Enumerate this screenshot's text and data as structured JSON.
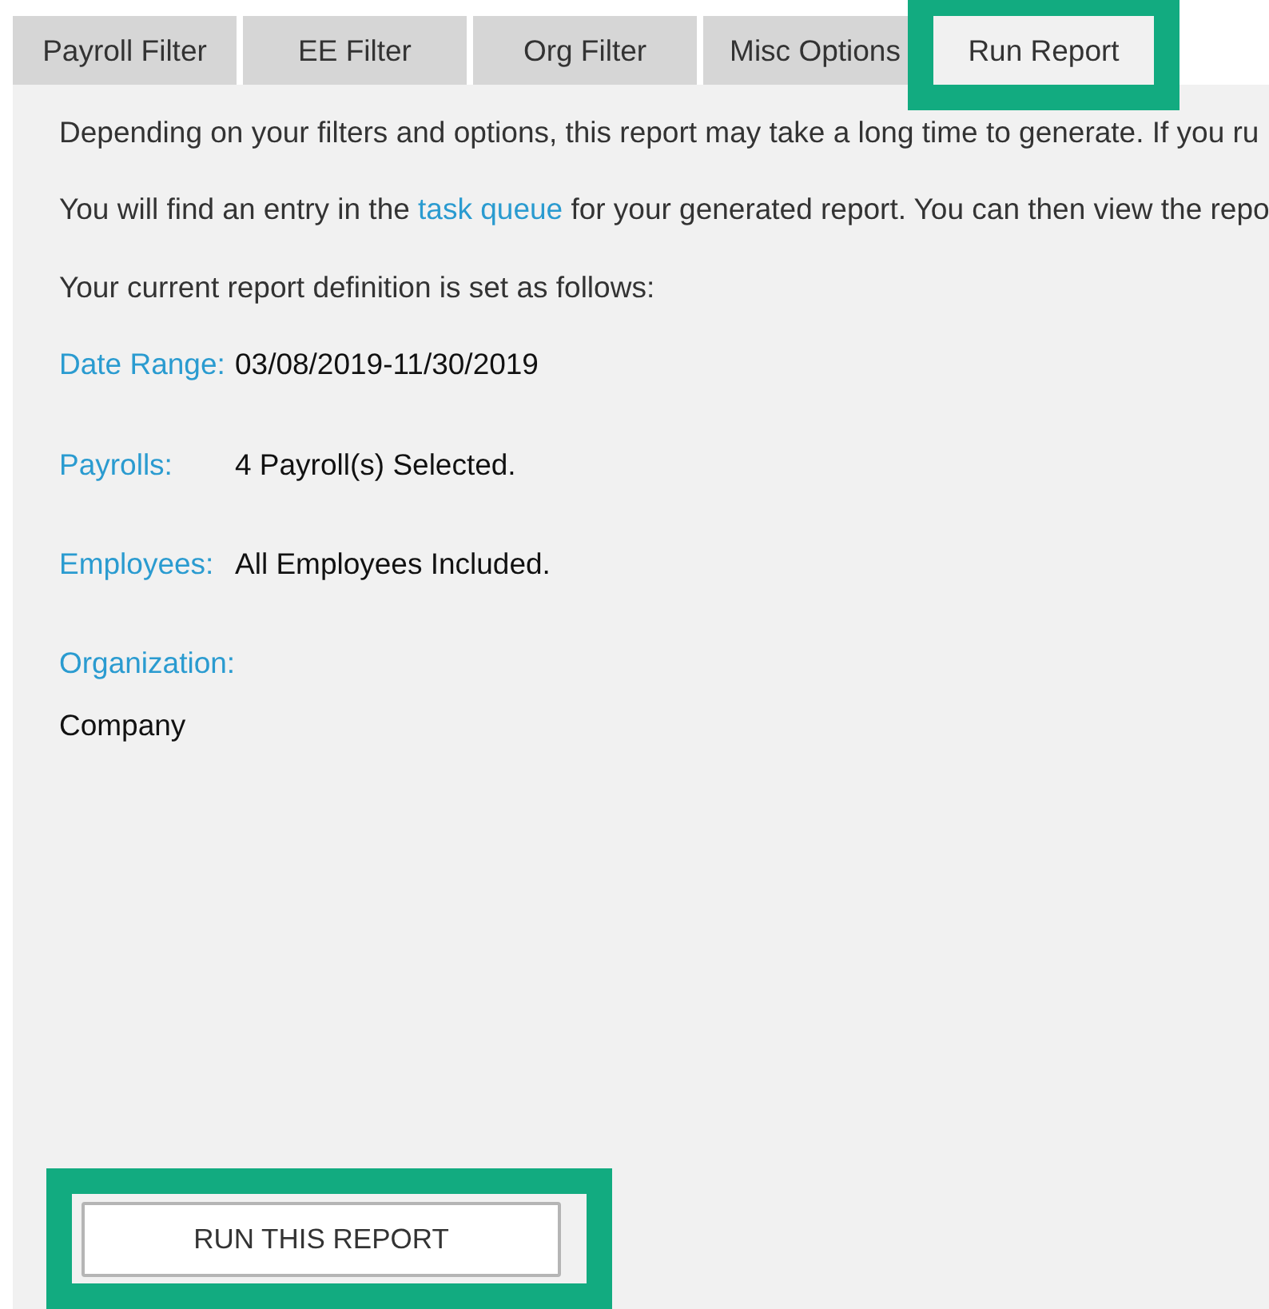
{
  "tabs": [
    {
      "label": "Payroll Filter",
      "selected": false,
      "highlighted": false
    },
    {
      "label": "EE Filter",
      "selected": false,
      "highlighted": false
    },
    {
      "label": "Org Filter",
      "selected": false,
      "highlighted": false
    },
    {
      "label": "Misc Options",
      "selected": false,
      "highlighted": false
    },
    {
      "label": "Run Report",
      "selected": true,
      "highlighted": true
    }
  ],
  "intro": [
    {
      "kind": "text",
      "parts": [
        {
          "text": "Depending on your filters and options, this report may take a long time to generate. If you ru"
        }
      ]
    },
    {
      "kind": "text",
      "parts": [
        {
          "text": "You will find an entry in the "
        },
        {
          "text": "task queue",
          "link": true
        },
        {
          "text": " for your generated report. You can then view the repo"
        }
      ]
    },
    {
      "kind": "text",
      "parts": [
        {
          "text": "Your current report definition is set as follows:"
        }
      ]
    }
  ],
  "definition": [
    {
      "label": "Date Range:",
      "value": "03/08/2019-11/30/2019",
      "kind": "inline"
    },
    {
      "label": "Payrolls:",
      "value": "4 Payroll(s) Selected.",
      "kind": "inline"
    },
    {
      "label": "Employees:",
      "value": "All Employees Included.",
      "kind": "inline"
    },
    {
      "label": "Organization:",
      "value": "Company",
      "kind": "stacked"
    }
  ],
  "run_button": {
    "label": "RUN THIS REPORT",
    "highlighted": true
  }
}
